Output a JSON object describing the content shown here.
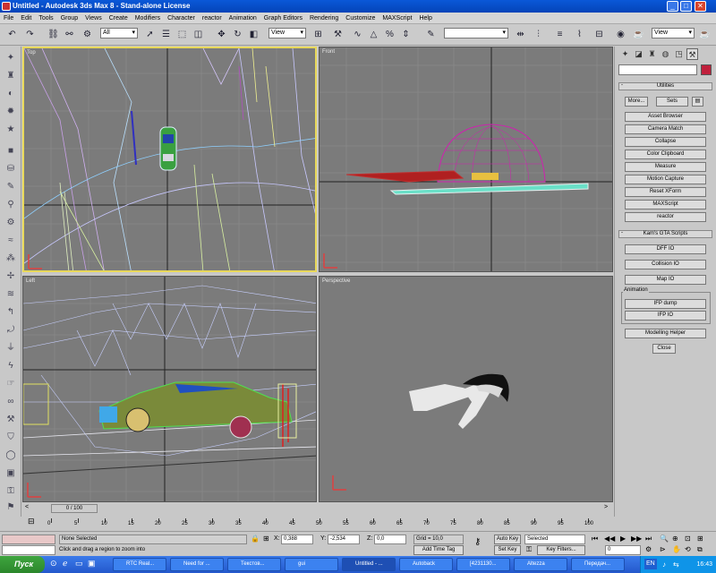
{
  "window": {
    "title": "Untitled - Autodesk 3ds Max 8 - Stand-alone License",
    "min": "_",
    "max": "□",
    "close": "✕"
  },
  "menu": [
    "File",
    "Edit",
    "Tools",
    "Group",
    "Views",
    "Create",
    "Modifiers",
    "Character",
    "reactor",
    "Animation",
    "Graph Editors",
    "Rendering",
    "Customize",
    "MAXScript",
    "Help"
  ],
  "toolbar": {
    "selection_filter": "All",
    "ref_coord": "View",
    "named_selection": "",
    "render_view": "View"
  },
  "viewports": {
    "top": "Top",
    "front": "Front",
    "left": "Left",
    "perspective": "Perspective"
  },
  "command_panel": {
    "utilities_rollout": "Utilities",
    "more_button": "More...",
    "sets_button": "Sets",
    "utilities": [
      "Asset Browser",
      "Camera Match",
      "Collapse",
      "Color Clipboard",
      "Measure",
      "Motion Capture",
      "Reset XForm",
      "MAXScript",
      "reactor"
    ],
    "gta_rollout": "Kam's GTA Scripts",
    "gta_scripts": [
      "DFF IO",
      "Collision IO",
      "Map IO"
    ],
    "animation_group": "Animation",
    "animation_scripts": [
      "IFP dump",
      "IFP IO"
    ],
    "modelling_helper": "Modelling Helper",
    "close": "Close",
    "swatch_color": "#c0203c"
  },
  "timeline": {
    "slider": "0 / 100",
    "ticks": [
      "0",
      "5",
      "10",
      "15",
      "20",
      "25",
      "30",
      "35",
      "40",
      "45",
      "50",
      "55",
      "60",
      "65",
      "70",
      "75",
      "80",
      "85",
      "90",
      "95",
      "100"
    ]
  },
  "status": {
    "selection": "None Selected",
    "prompt": "Click and drag a region to zoom into",
    "x_label": "X:",
    "x_value": "0,388",
    "y_label": "Y:",
    "y_value": "-2,534",
    "z_label": "Z:",
    "z_value": "0,0",
    "grid": "Grid = 10,0",
    "add_time_tag": "Add Time Tag",
    "auto_key": "Auto Key",
    "set_key": "Set Key",
    "key_mode": "Selected",
    "key_filters": "Key Filters...",
    "frame": "0"
  },
  "taskbar": {
    "start": "Пуск",
    "tasks": [
      "RTC Real...",
      "Need for ...",
      "Текстов...",
      "gui",
      "Untitled - ...",
      "Autoback",
      "[4231130...",
      "Altezza",
      "Передач..."
    ],
    "clock": "16:43",
    "lang": "EN"
  }
}
